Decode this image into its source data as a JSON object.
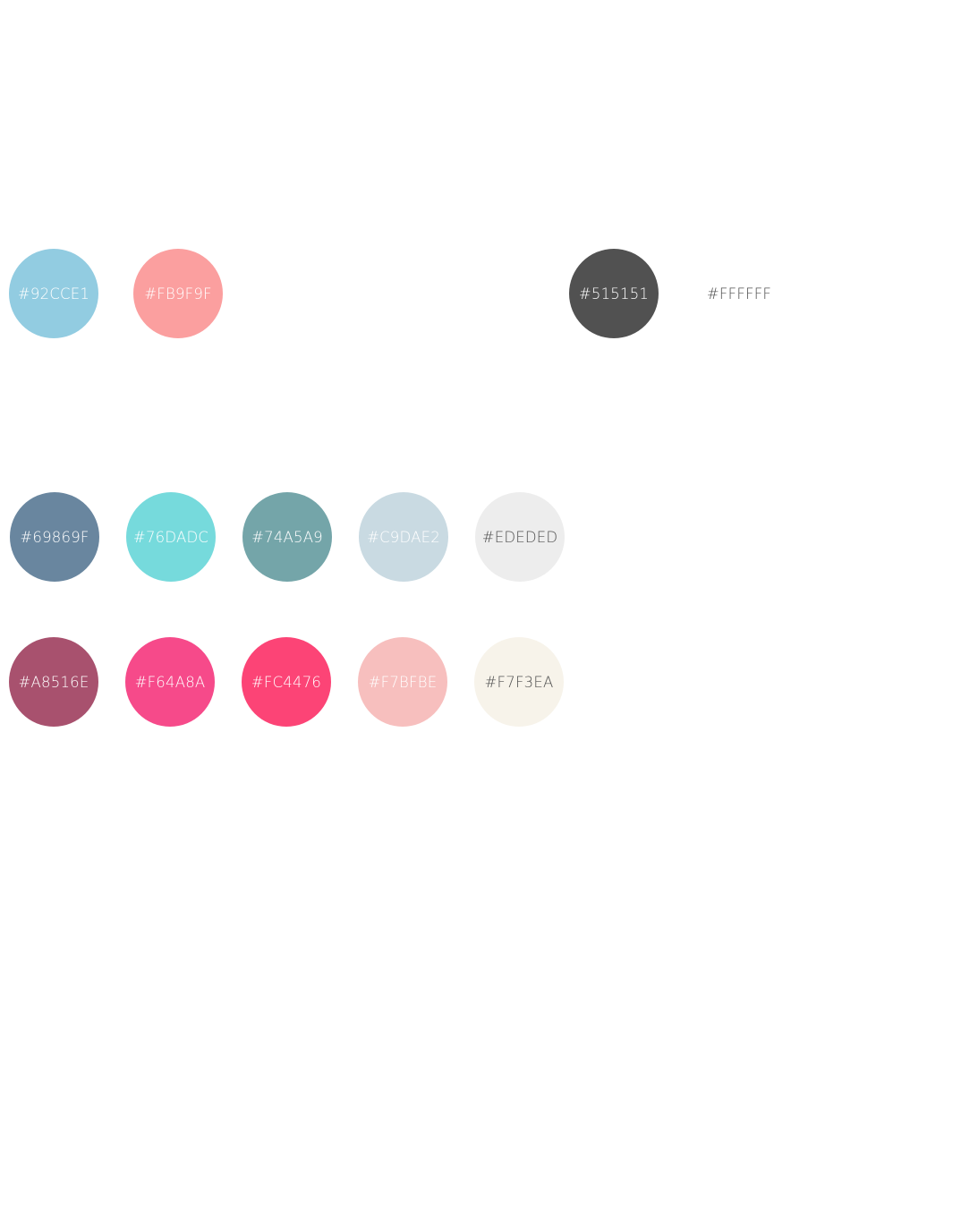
{
  "swatches": {
    "primary": [
      {
        "label": "#92CCE1",
        "color": "#92CCE1",
        "text_color": "#FFFFFF"
      },
      {
        "label": "#FB9F9F",
        "color": "#FB9F9F",
        "text_color": "#FFFFFF"
      }
    ],
    "neutral": [
      {
        "label": "#515151",
        "color": "#515151",
        "text_color": "#FFFFFF"
      },
      {
        "label": "#FFFFFF",
        "color": "#FFFFFF",
        "text_color": "#515151"
      }
    ],
    "cool": [
      {
        "label": "#69869F",
        "color": "#69869F",
        "text_color": "#FFFFFF"
      },
      {
        "label": "#76DADC",
        "color": "#76DADC",
        "text_color": "#FFFFFF"
      },
      {
        "label": "#74A5A9",
        "color": "#74A5A9",
        "text_color": "#FFFFFF"
      },
      {
        "label": "#C9DAE2",
        "color": "#C9DAE2",
        "text_color": "#FFFFFF"
      },
      {
        "label": "#EDEDED",
        "color": "#EDEDED",
        "text_color": "#515151"
      }
    ],
    "warm": [
      {
        "label": "#A8516E",
        "color": "#A8516E",
        "text_color": "#FFFFFF"
      },
      {
        "label": "#F64A8A",
        "color": "#F64A8A",
        "text_color": "#FFFFFF"
      },
      {
        "label": "#FC4476",
        "color": "#FC4476",
        "text_color": "#FFFFFF"
      },
      {
        "label": "#F7BFBE",
        "color": "#F7BFBE",
        "text_color": "#FFFFFF"
      },
      {
        "label": "#F7F3EA",
        "color": "#F7F3EA",
        "text_color": "#515151"
      }
    ]
  }
}
